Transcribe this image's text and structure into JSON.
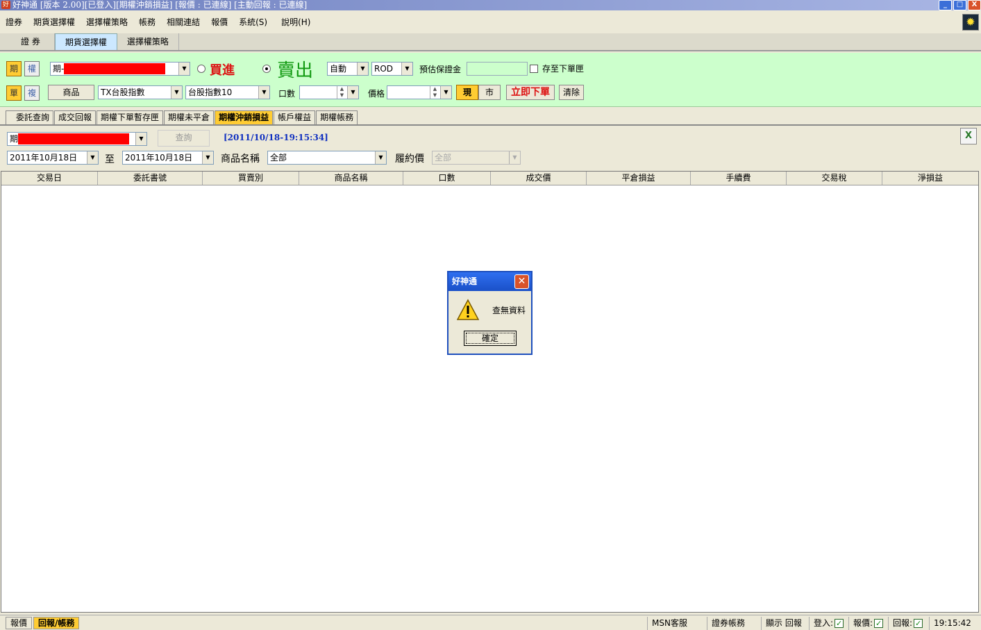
{
  "window": {
    "title": "好神通 [版本 2.00][已登入][期權沖銷損益] [報價 : 已連線] [主動回報 : 已連線]",
    "min": "_",
    "max": "□",
    "close": "X"
  },
  "menu": {
    "items": [
      "證券",
      "期貨選擇權",
      "選擇權策略",
      "帳務",
      "相關連結",
      "報價",
      "系統(S)",
      "說明(H)"
    ]
  },
  "top_tabs": [
    "證 券",
    "期貨選擇權",
    "選擇權策略"
  ],
  "order": {
    "mode_futures": "期",
    "mode_options": "權",
    "account_prefix": "期-",
    "buy_label": "買進",
    "sell_label": "賣出",
    "auto_select": "自動",
    "rod_select": "ROD",
    "margin_label": "預估保證金",
    "save_to_box_label": "存至下單匣",
    "single_btn": "單",
    "dup_btn": "複",
    "product_btn": "商品",
    "product_select": "TX台股指數",
    "contract_select": "台股指數10",
    "qty_label": "口數",
    "price_label": "價格",
    "limit_btn": "現",
    "market_btn": "市",
    "submit_btn": "立即下單",
    "clear_btn": "清除"
  },
  "sub_tabs": [
    "委託查詢",
    "成交回報",
    "期權下單暫存匣",
    "期權未平倉",
    "期權沖銷損益",
    "帳戶權益",
    "期權帳務"
  ],
  "query": {
    "account_prefix": "期",
    "query_btn": "查詢",
    "timestamp": "[2011/10/18-19:15:34]",
    "date_from": "2011年10月18日",
    "to_label": "至",
    "date_to": "2011年10月18日",
    "product_name_label": "商品名稱",
    "product_name_value": "全部",
    "strike_label": "履約價",
    "strike_value": "全部"
  },
  "table": {
    "columns": [
      "交易日",
      "委託書號",
      "買賣別",
      "商品名稱",
      "口數",
      "成交價",
      "平倉損益",
      "手續費",
      "交易稅",
      "淨損益"
    ]
  },
  "dialog": {
    "title": "好神通",
    "message": "查無資料",
    "ok": "確定"
  },
  "status": {
    "tab_quote": "報價",
    "tab_report": "回報/帳務",
    "msn": "MSN客服",
    "sec_account": "證券帳務",
    "show_report": "顯示 回報",
    "login_label": "登入:",
    "quote_label": "報價:",
    "report_label": "回報:",
    "check": "✓",
    "time": "19:15:42"
  },
  "colors": {
    "order_panel_bg": "#ccffcc",
    "active_tab": "#ffcc33",
    "buy_red": "#dd1111",
    "sell_green": "#119911",
    "submit_red": "#dd1111",
    "timestamp_blue": "#1030c0"
  }
}
